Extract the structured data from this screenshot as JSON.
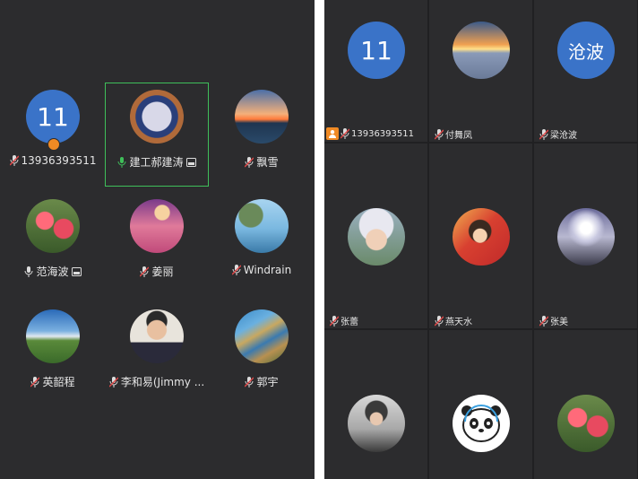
{
  "left_grid": {
    "tiles": [
      {
        "name": "13936393511",
        "avatar_text": "11"
      },
      {
        "name": "建工郝建涛"
      },
      {
        "name": "飘雪"
      },
      {
        "name": "范海波"
      },
      {
        "name": "姜丽"
      },
      {
        "name": "Windrain"
      },
      {
        "name": "英韶程"
      },
      {
        "name": "李和易(Jimmy ..."
      },
      {
        "name": "郭宇"
      }
    ]
  },
  "right_grid": {
    "tiles": [
      {
        "name": "13936393511",
        "avatar_text": "11"
      },
      {
        "name": "付舞凤"
      },
      {
        "name": "梁沧波",
        "avatar_text": "沧波"
      },
      {
        "name": "张蕾"
      },
      {
        "name": "燕天水"
      },
      {
        "name": "张美"
      },
      {
        "name": ""
      },
      {
        "name": ""
      },
      {
        "name": ""
      }
    ]
  },
  "colors": {
    "panel_bg": "#2c2c2e",
    "avatar_blue": "#3a73c8",
    "active_speaker_border": "#3fbf5a",
    "host_badge": "#f08a24",
    "mic_muted": "#e04848",
    "mic_active": "#3fbf5a"
  }
}
